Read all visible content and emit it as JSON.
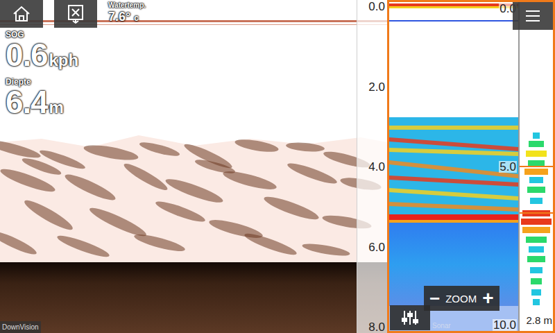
{
  "water_temp": {
    "label": "Watertemp.",
    "value": "7.6°",
    "unit": "c"
  },
  "sog": {
    "label": "SOG",
    "value": "0.6",
    "unit": "kph"
  },
  "depth": {
    "label": "Diepte",
    "value": "6.4",
    "unit": "m"
  },
  "downvision": {
    "title": "DownVision",
    "scale": [
      "0.0",
      "2.0",
      "4.0",
      "6.0",
      "8.0"
    ]
  },
  "sonar": {
    "title": "Sonar",
    "scale": [
      "0.0",
      "5.0",
      "10.0"
    ],
    "zoom": {
      "label": "ZOOM",
      "minus": "−",
      "plus": "+"
    }
  },
  "ascope": {
    "range": "2.8 m"
  }
}
